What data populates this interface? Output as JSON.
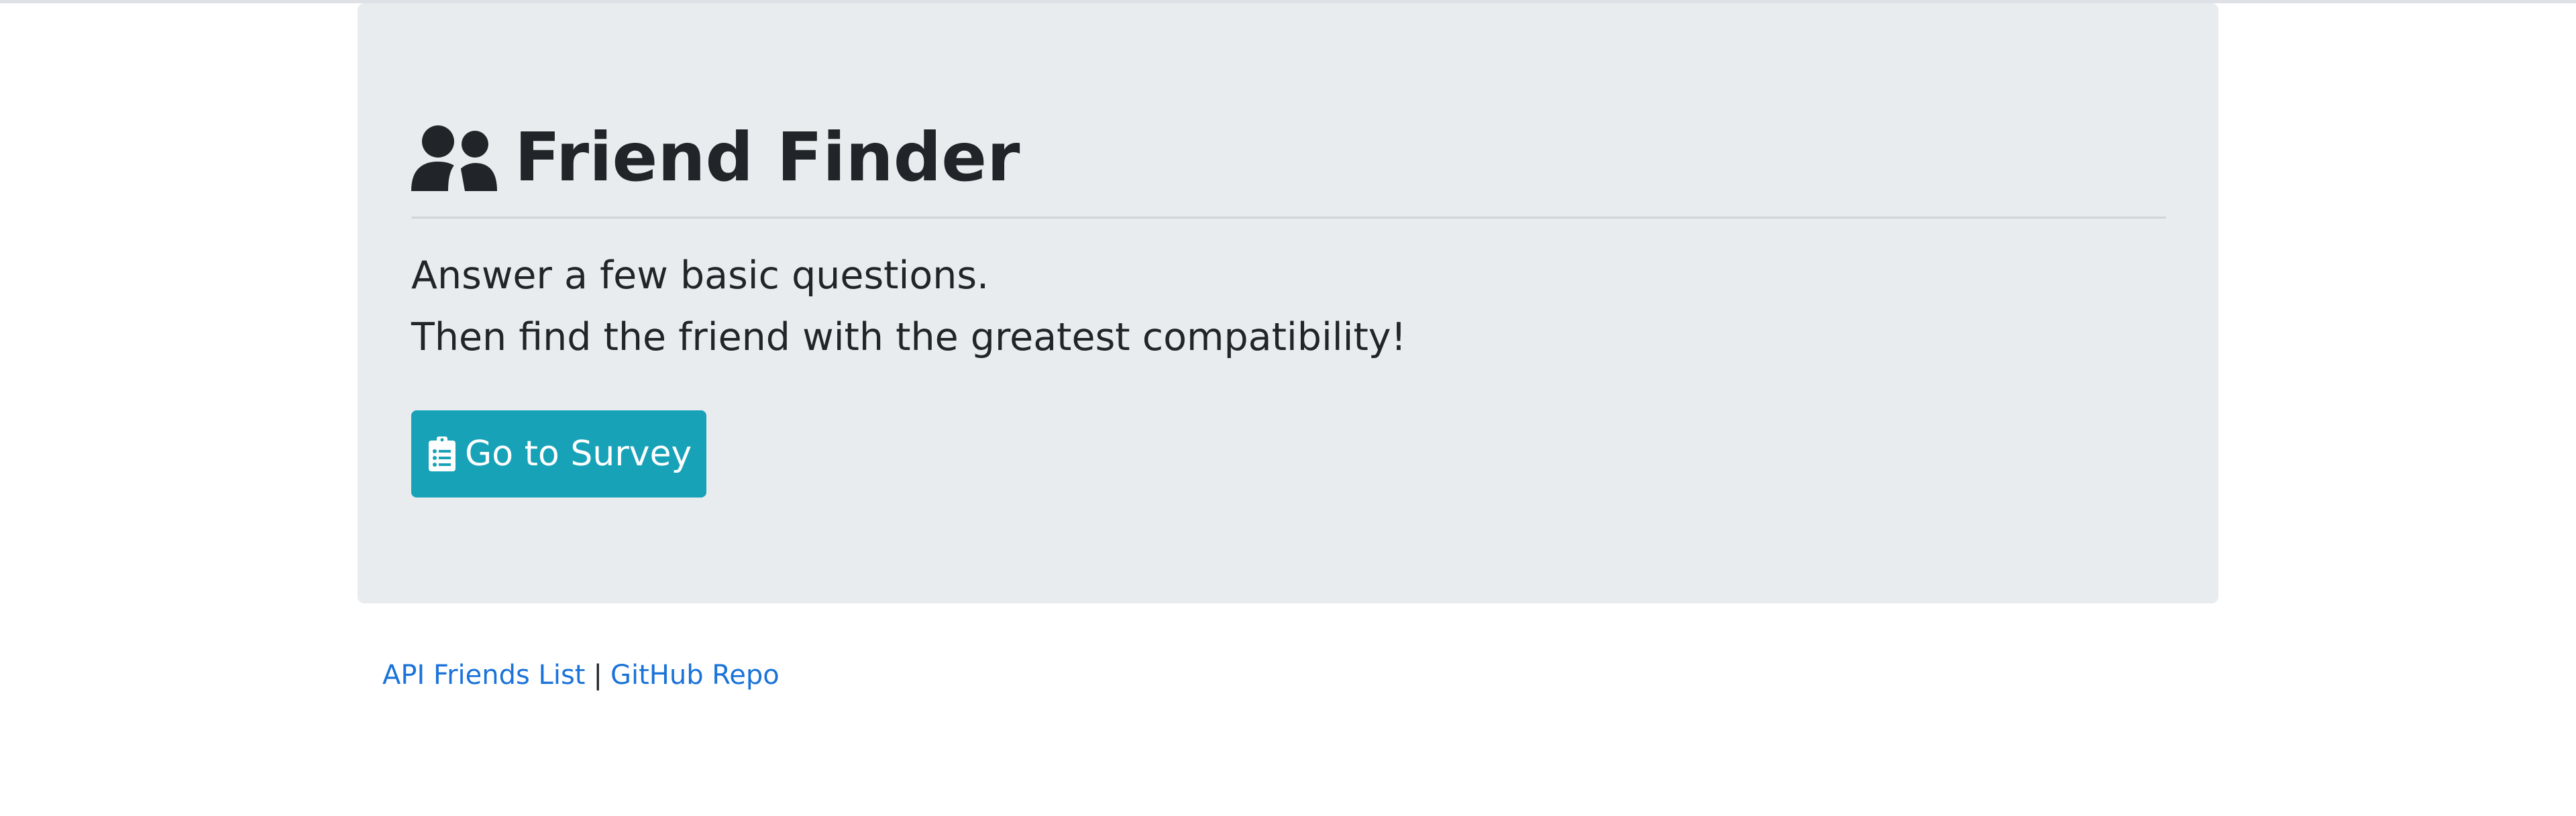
{
  "hero": {
    "title": "Friend Finder",
    "title_icon": "users-icon",
    "lead_line_1": "Answer a few basic questions.",
    "lead_line_2": "Then find the friend with the greatest compatibility!",
    "button": {
      "label": "Go to Survey",
      "icon": "clipboard-list-icon",
      "color": "#17a2b8"
    },
    "background_color": "#e9ecef"
  },
  "footer": {
    "link_1": "API Friends List",
    "separator": "|",
    "link_2": "GitHub Repo",
    "link_color": "#1a73d9"
  }
}
